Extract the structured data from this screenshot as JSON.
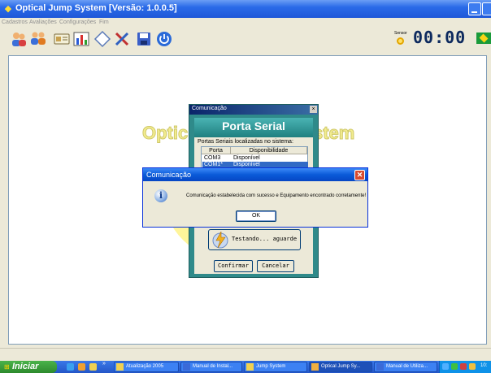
{
  "window": {
    "title": "Optical Jump System [Versão: 1.0.0.5]"
  },
  "menu": {
    "items": [
      "Cadastros",
      "Avaliações",
      "Configurações",
      "Fim"
    ]
  },
  "toolbar": {
    "icons": [
      "users-icon",
      "group-icon",
      "card-icon",
      "chart-icon",
      "diamond-icon",
      "tools-icon",
      "save-icon",
      "power-icon"
    ],
    "sensor_label": "Sensor",
    "timer": "00:00"
  },
  "watermark": {
    "left": "Optic",
    "right": "stem"
  },
  "serial_dialog": {
    "title": "Comunicação",
    "close": "×",
    "heading": "Porta Serial",
    "ports_label": "Portas Seriais localizadas no sistema:",
    "columns": [
      "Porta",
      "Disponibilidade"
    ],
    "rows": [
      {
        "port": "COM3",
        "status": "Disponível"
      },
      {
        "port": "COM1*",
        "status": "Disponível"
      }
    ],
    "test_button": "Testando... aguarde",
    "confirm_button": "Confirmar",
    "cancel_button": "Cancelar"
  },
  "message_box": {
    "title": "Comunicação",
    "close": "✕",
    "icon_glyph": "i",
    "message": "Comunicação estabelecida com sucesso e Equipamento encontrado corretamente!",
    "ok_button": "OK"
  },
  "taskbar": {
    "start_label": "Iniciar",
    "quick_more": "»",
    "tasks": [
      "Atualização 2005",
      "Manual de Instal...",
      "Jump System",
      "Optical Jump Sy...",
      "Manual de Utiliza..."
    ],
    "clock": "10:"
  },
  "colors": {
    "xp_blue": "#2a6ae8",
    "dialog_teal": "#2f8a8a",
    "timer_text": "#0d2a5e",
    "start_green": "#3a9d3a"
  }
}
